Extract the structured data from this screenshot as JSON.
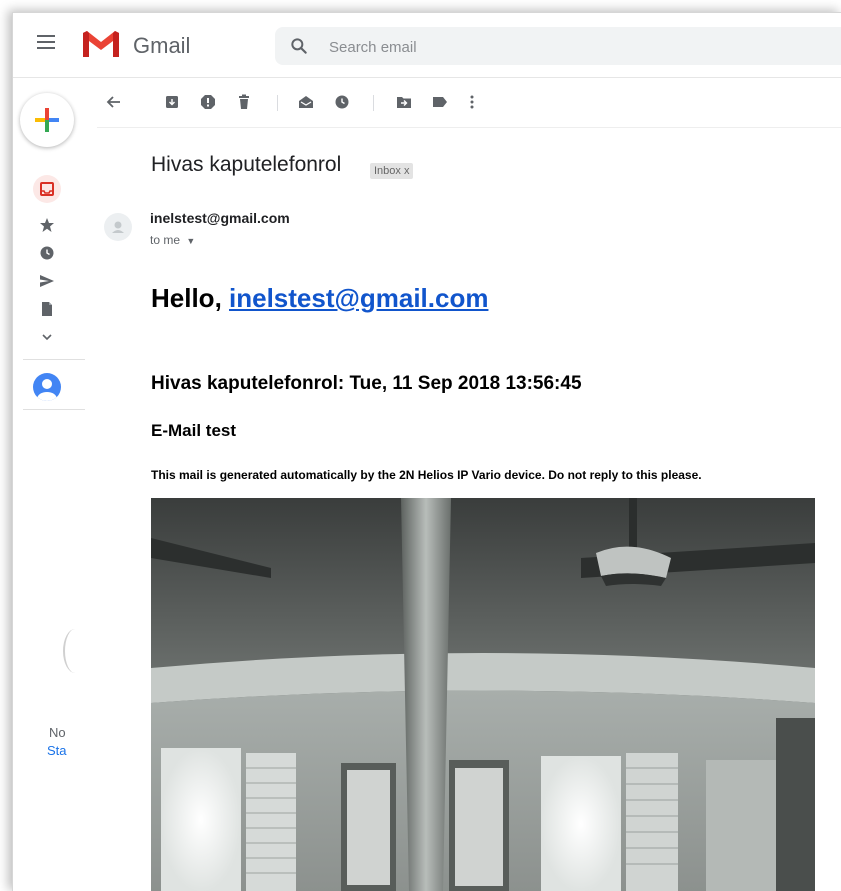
{
  "app": {
    "brand": "Gmail"
  },
  "search": {
    "placeholder": "Search email"
  },
  "toolbar": {
    "items": [
      "back",
      "archive",
      "report-spam",
      "delete",
      "mark-as-unread",
      "snooze",
      "move-to",
      "labels",
      "more"
    ]
  },
  "rail": {
    "items": [
      "inbox",
      "starred",
      "snoozed",
      "sent",
      "drafts",
      "more"
    ],
    "footer_line1": "No",
    "footer_line2": "Sta"
  },
  "message": {
    "subject": "Hivas kaputelefonrol",
    "label_chip": "Inbox x",
    "sender": "inelstest@gmail.com",
    "recipient": "to me",
    "greeting": "Hello, ",
    "greeting_email": "inelstest@gmail.com",
    "heading": "Hivas kaputelefonrol: Tue, 11 Sep 2018 13:56:45",
    "subheading": "E-Mail test",
    "note": "This mail is generated automatically by the 2N Helios IP Vario device. Do not reply to this please."
  },
  "colors": {
    "gmail_red": "#ea4335",
    "link": "#1155cc",
    "icon_grey": "#5f6368",
    "accent_blue": "#4285f4"
  }
}
